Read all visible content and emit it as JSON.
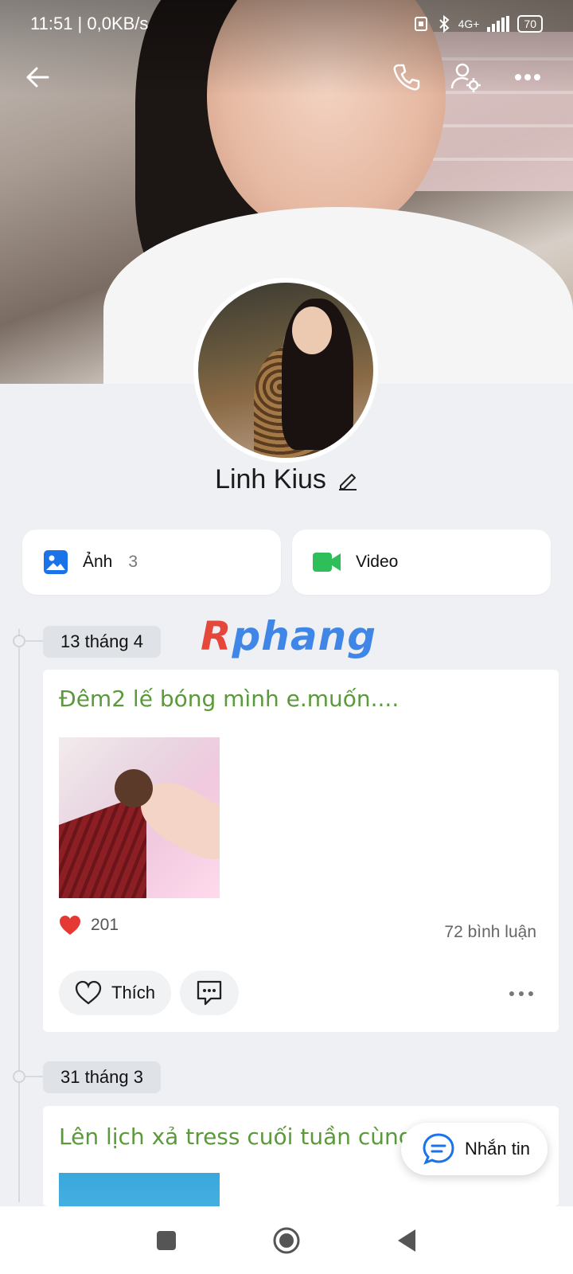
{
  "status_bar": {
    "time_speed": "11:51 | 0,0KB/s",
    "network": "4G+",
    "battery": "70"
  },
  "profile": {
    "name": "Linh Kius"
  },
  "media": {
    "photos_label": "Ảnh",
    "photos_count": "3",
    "video_label": "Video"
  },
  "watermark": "Rphang",
  "posts": [
    {
      "date": "13 tháng 4",
      "text": "Đêm2 lế bóng mình e.muốn....",
      "likes": "201",
      "comments": "72 bình luận",
      "like_label": "Thích"
    },
    {
      "date": "31 tháng 3",
      "text": "Lên lịch xả tress cuối tuần cùng e đi a"
    }
  ],
  "fab": {
    "label": "Nhắn tin"
  },
  "colors": {
    "post_text": "#5a9a3a",
    "photo_icon": "#1a73e8",
    "video_icon": "#2fbf5a",
    "heart": "#e53935"
  }
}
